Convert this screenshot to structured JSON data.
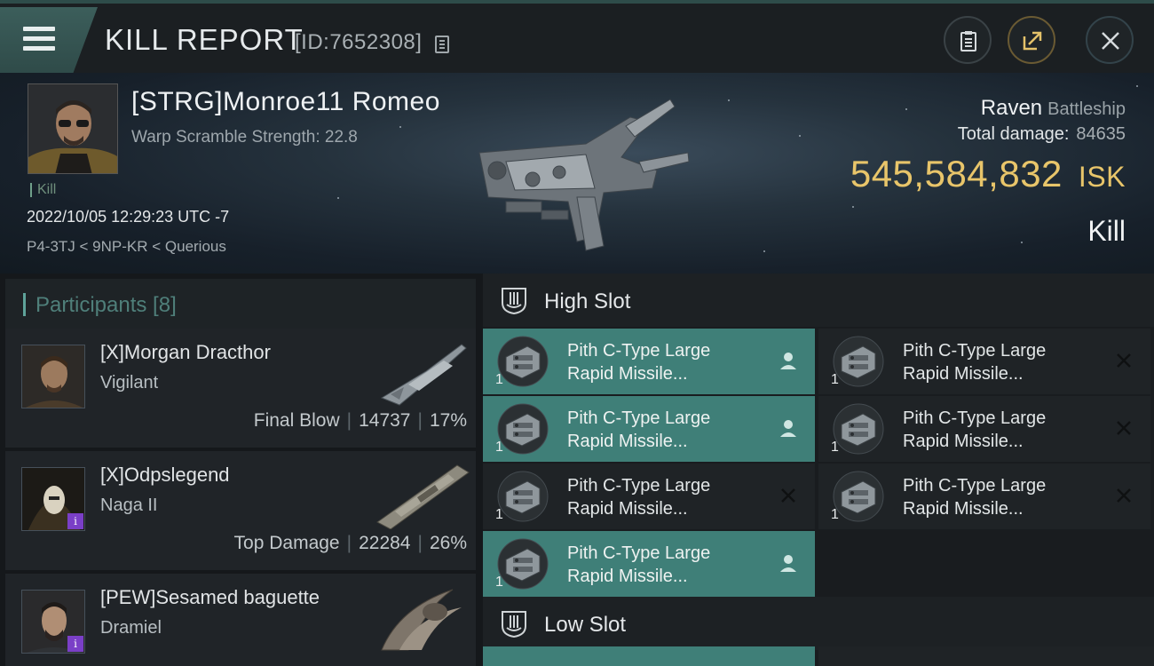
{
  "header": {
    "title": "KILL REPORT",
    "report_id": "[ID:7652308]"
  },
  "victim": {
    "name": "[STRG]Monroe11 Romeo",
    "warp_scramble": "Warp Scramble Strength: 22.8",
    "tag": "Kill",
    "datetime": "2022/10/05 12:29:23 UTC -7",
    "location": "P4-3TJ < 9NP-KR < Querious",
    "ship_name": "Raven",
    "ship_class": "Battleship",
    "total_damage_label": "Total damage:",
    "total_damage": "84635",
    "isk_value": "545,584,832",
    "isk_unit": "ISK",
    "result": "Kill"
  },
  "participants": {
    "label": "Participants [8]",
    "items": [
      {
        "name": "[X]Morgan Dracthor",
        "ship": "Vigilant",
        "role": "Final Blow",
        "damage": "14737",
        "percent": "17%"
      },
      {
        "name": "[X]Odpslegend",
        "ship": "Naga II",
        "role": "Top Damage",
        "damage": "22284",
        "percent": "26%"
      },
      {
        "name": "[PEW]Sesamed baguette",
        "ship": "Dramiel"
      }
    ]
  },
  "fitting": {
    "high_slot_label": "High Slot",
    "low_slot_label": "Low Slot",
    "module_line1": "Pith C-Type Large",
    "module_line2": "Rapid Missile...",
    "quantity": "1",
    "high_slots": [
      {
        "status": "dropped"
      },
      {
        "status": "destroyed"
      },
      {
        "status": "dropped"
      },
      {
        "status": "destroyed"
      },
      {
        "status": "destroyed"
      },
      {
        "status": "destroyed"
      },
      {
        "status": "dropped"
      }
    ]
  },
  "colors": {
    "accent_teal": "#3f7f78",
    "isk_gold": "#e8c56a"
  }
}
